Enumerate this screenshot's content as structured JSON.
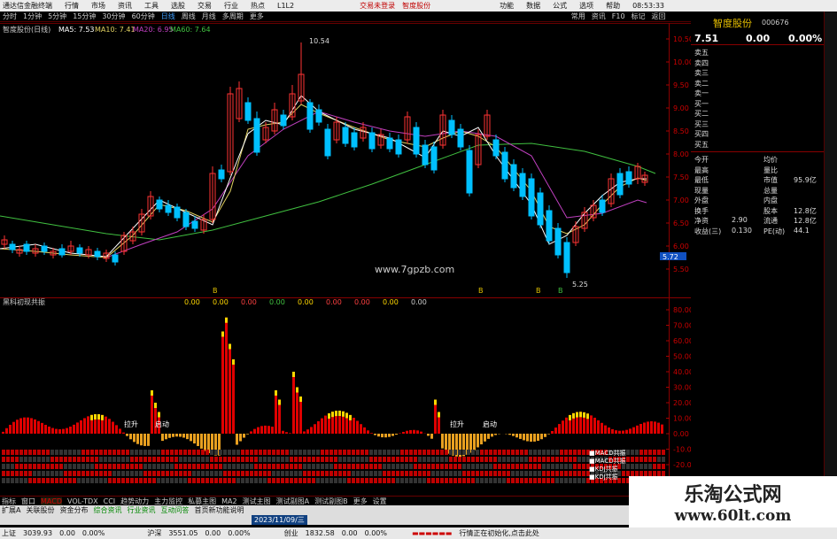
{
  "titlebar": {
    "app": "通达信金融终端",
    "menus": [
      "行情",
      "市场",
      "资讯",
      "工具",
      "选股",
      "交易",
      "行业",
      "热点",
      "L1L2"
    ],
    "trade_login": "交易未登录",
    "stock_link": "智度股份",
    "right": [
      "功能",
      "数据",
      "公式",
      "选项",
      "帮助",
      "08:53:33"
    ]
  },
  "toolbar": {
    "periods": [
      "分时",
      "1分钟",
      "5分钟",
      "15分钟",
      "30分钟",
      "60分钟",
      "日线",
      "周线",
      "月线",
      "多周期",
      "更多"
    ],
    "right": [
      "常用",
      "资讯",
      "F10",
      "标记",
      "返回"
    ]
  },
  "main_chart": {
    "header": "智度股份(日线)",
    "ma5": "MA5: 7.53",
    "ma10": "MA10: 7.41",
    "ma20": "MA20: 6.95",
    "ma60": "MA60: 7.64",
    "high_label": "10.54",
    "low_label": "5.25",
    "watermark": "www.7gpzb.com",
    "price_ticks": [
      "10.50",
      "10.00",
      "9.50",
      "9.00",
      "8.50",
      "8.00",
      "7.50",
      "7.00",
      "6.50",
      "6.00",
      "5.50"
    ],
    "current_price_tag": "5.72",
    "markers": [
      "B",
      "B",
      "B",
      "B"
    ]
  },
  "indicator": {
    "header": "黑科初现共振",
    "values": [
      "0.00",
      "0.00",
      "0.00",
      "0.00",
      "0.00",
      "0.00",
      "0.00",
      "0.00",
      "0.00"
    ],
    "ticks": [
      "80.00",
      "70.00",
      "60.00",
      "50.00",
      "40.00",
      "30.00",
      "20.00",
      "10.00",
      "0.00",
      "-10.00",
      "-20.00",
      "-30.00",
      "-40.00"
    ],
    "labels": [
      "拉升",
      "启动",
      "拉升",
      "启动"
    ],
    "legend": [
      "MACD共振",
      "MACD共振",
      "KDJ共振",
      "KDJ共振"
    ]
  },
  "quote": {
    "name": "智度股份",
    "code": "000676",
    "price": "7.51",
    "change": "0.00",
    "change_pct": "0.00%",
    "sell": [
      "卖五",
      "卖四",
      "卖三",
      "卖二",
      "卖一"
    ],
    "buy": [
      "买一",
      "买二",
      "买三",
      "买四",
      "买五"
    ],
    "stats_left": [
      [
        "今开",
        ""
      ],
      [
        "最高",
        ""
      ],
      [
        "最低",
        ""
      ],
      [
        "现量",
        ""
      ],
      [
        "外盘",
        ""
      ],
      [
        "换手",
        ""
      ],
      [
        "净资",
        "2.90"
      ],
      [
        "收益(三)",
        "0.130"
      ]
    ],
    "stats_right": [
      [
        "均价",
        ""
      ],
      [
        "量比",
        ""
      ],
      [
        "市值",
        "95.9亿"
      ],
      [
        "总量",
        ""
      ],
      [
        "内盘",
        ""
      ],
      [
        "股本",
        "12.8亿"
      ],
      [
        "流通",
        "12.8亿"
      ],
      [
        "PE(动)",
        "44.1"
      ]
    ]
  },
  "bottom_tabs": {
    "row1": [
      "指标",
      "窗口",
      "MACD",
      "VOL-TDX",
      "CCI",
      "趋势动力",
      "主力监控",
      "私募主图",
      "MA2",
      "测试主图",
      "测试副图A",
      "测试副图B",
      "更多",
      "设置"
    ],
    "row2": [
      "扩展A",
      "关联股份",
      "资金分布",
      "综合资讯",
      "行业资讯",
      "互动问答",
      "首页新功能说明"
    ],
    "row3_date": "2023/11/09/三"
  },
  "statusbar": {
    "index1_name": "上证",
    "index1_val": "3039.93",
    "index1_chg": "0.00",
    "index1_pct": "0.00%",
    "index2_name": "沪深",
    "index2_val": "3551.05",
    "index2_chg": "0.00",
    "index2_pct": "0.00%",
    "index3_name": "创业",
    "index3_val": "1832.58",
    "index3_chg": "0.00",
    "index3_pct": "0.00%",
    "status": "行情正在初始化,点击此处"
  },
  "watermark_box": {
    "title": "乐淘公式网",
    "url": "www.60lt.com"
  },
  "colors": {
    "up": "#ff3333",
    "down": "#00c0ff",
    "ma5": "#ffffff",
    "ma10": "#e0d060",
    "ma20": "#c040c0",
    "ma60": "#40c040",
    "bar_red": "#e00000",
    "bar_yellow": "#ffd700",
    "bar_orange": "#e8a020"
  }
}
